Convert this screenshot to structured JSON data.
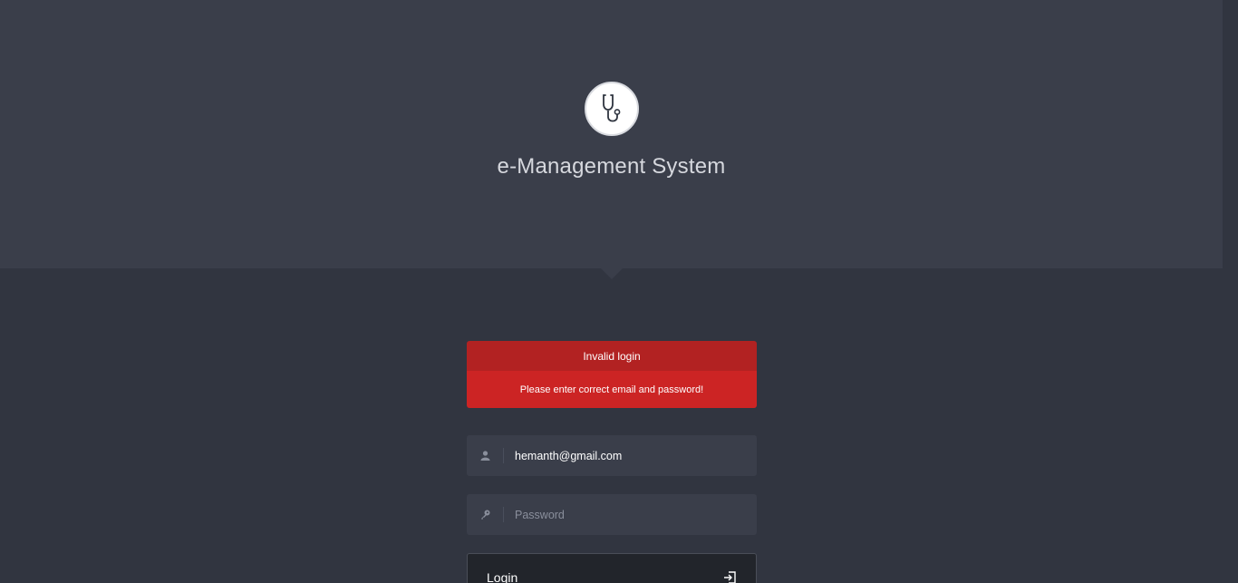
{
  "app": {
    "title": "e-Management System",
    "logo_icon": "stethoscope-icon"
  },
  "alert": {
    "heading": "Invalid login",
    "message": "Please enter correct email and password!",
    "color_head": "#b22222",
    "color_body": "#cc2424"
  },
  "form": {
    "email": {
      "value": "hemanth@gmail.com",
      "placeholder": "",
      "icon": "user-icon"
    },
    "password": {
      "value": "",
      "placeholder": "Password",
      "icon": "key-icon"
    },
    "login_label": "Login",
    "login_icon": "sign-in-icon"
  },
  "colors": {
    "background": "#313540",
    "header": "#3a3e4a"
  }
}
